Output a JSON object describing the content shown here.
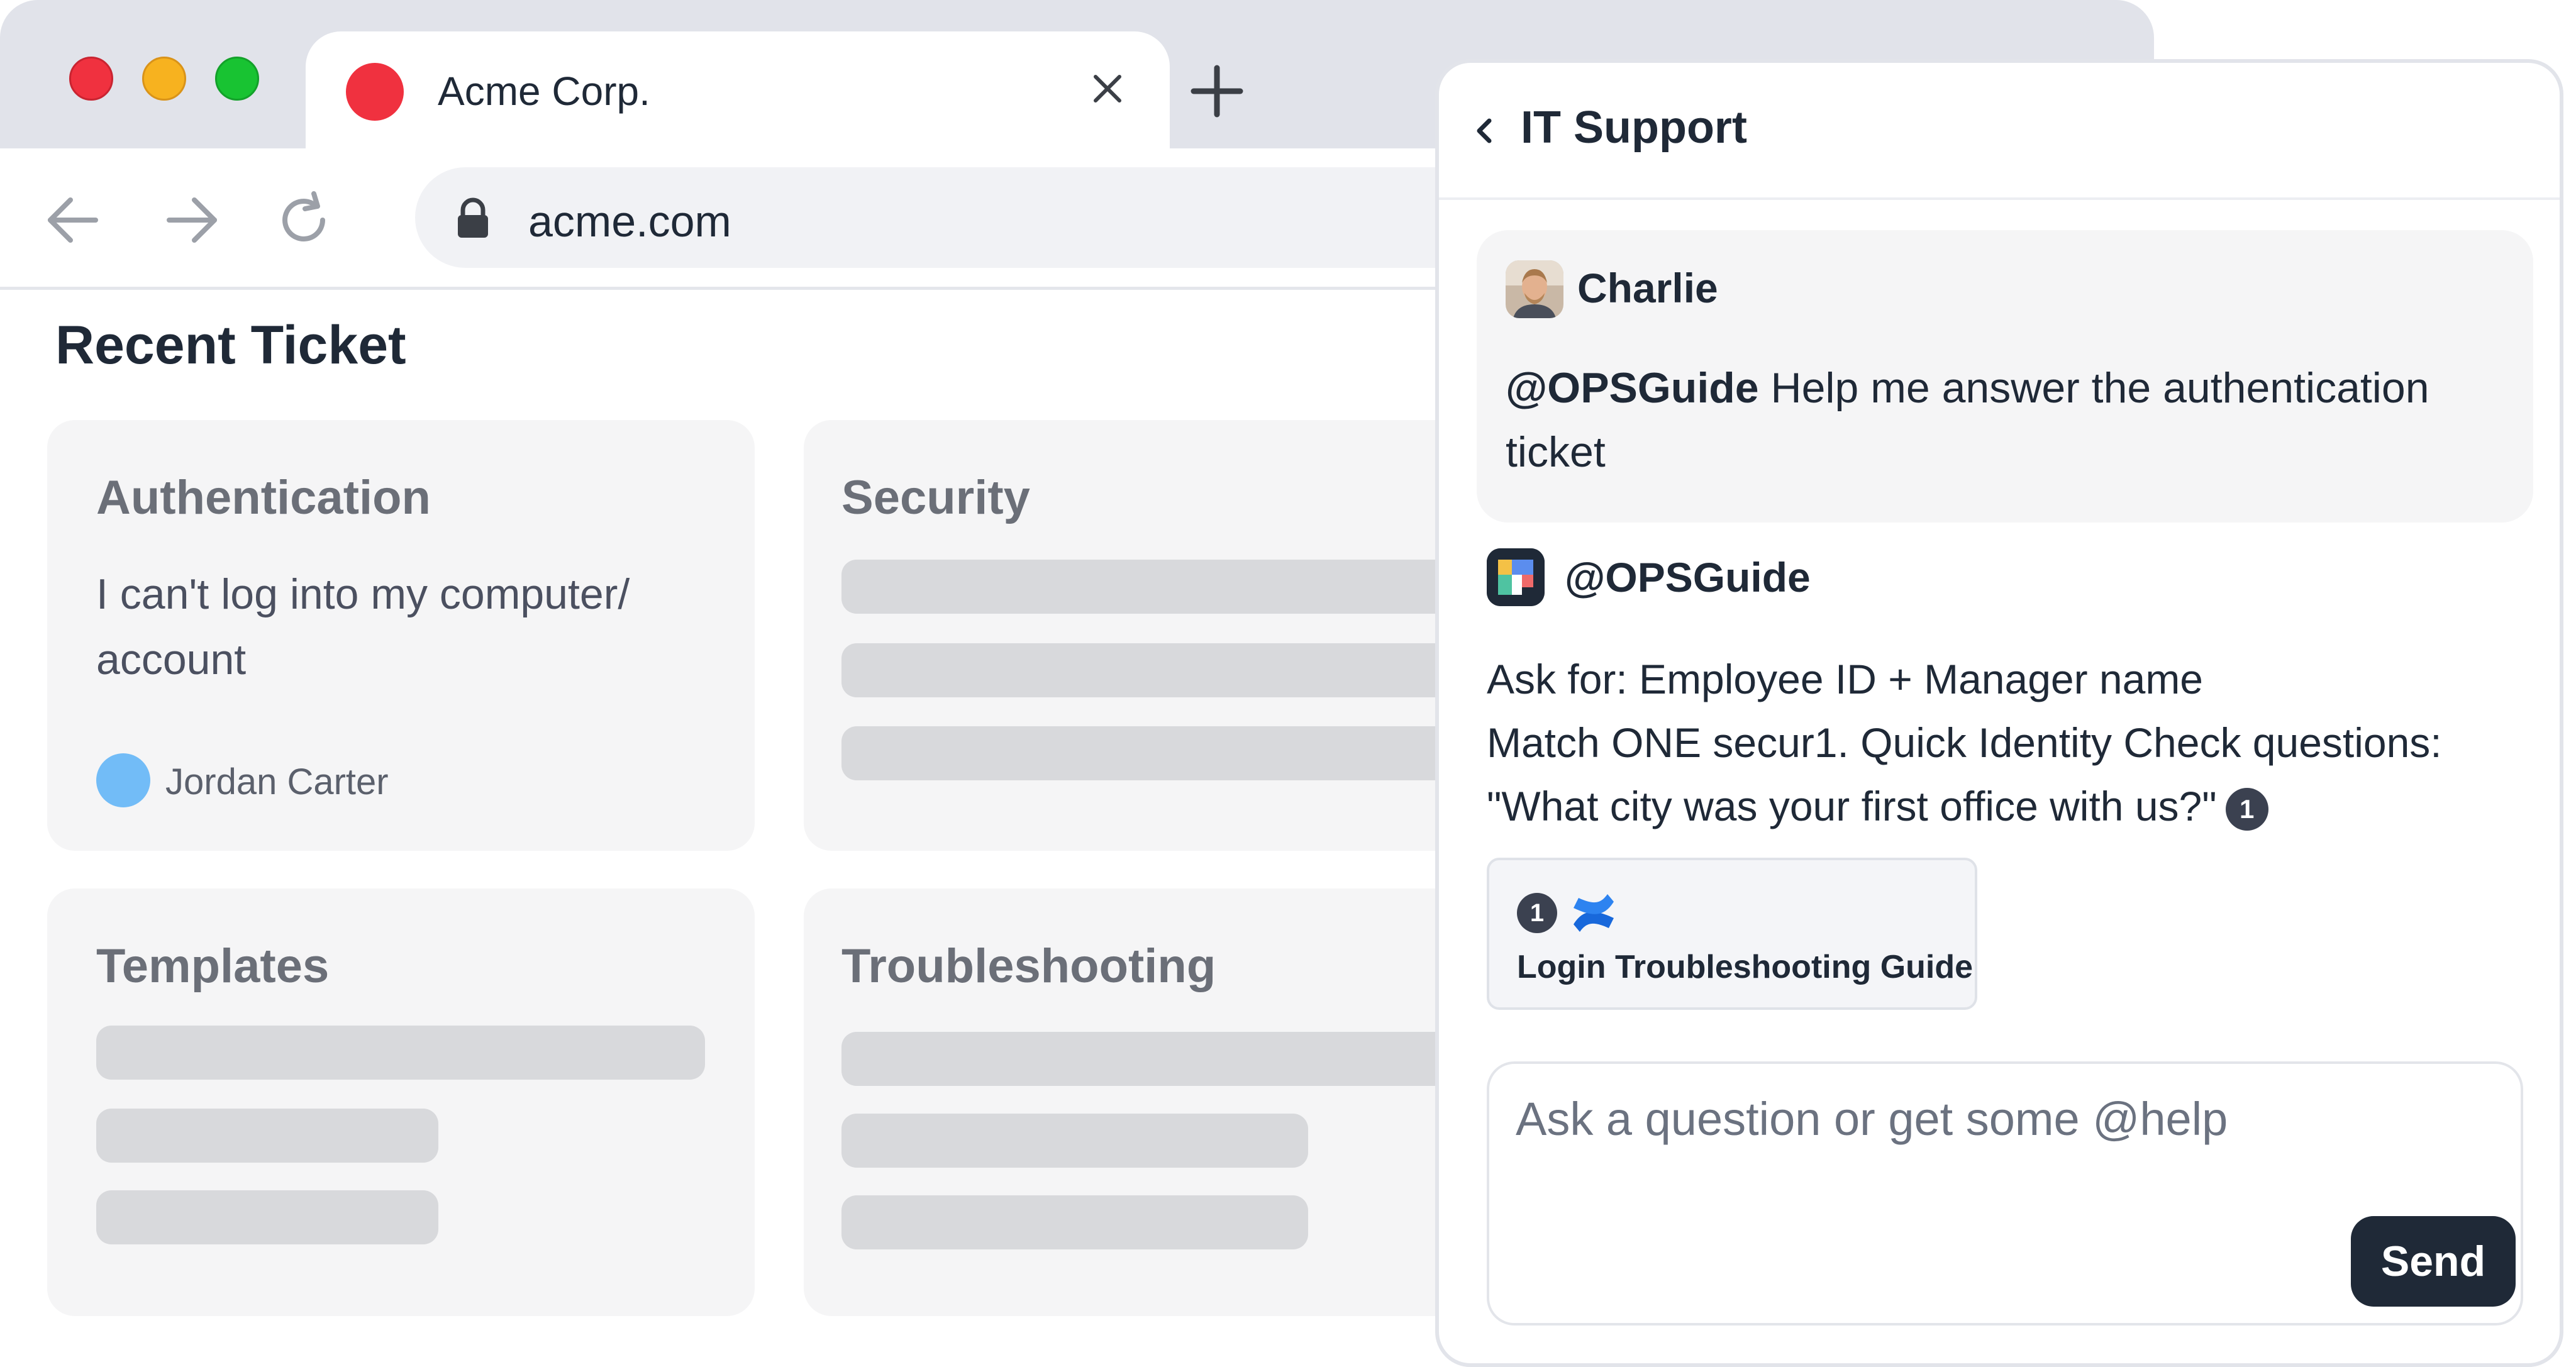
{
  "browser": {
    "tab": {
      "title": "Acme Corp.",
      "favicon_color": "#F0313F"
    },
    "address": {
      "url": "acme.com"
    },
    "icons": [
      "back-arrow-icon",
      "forward-arrow-icon",
      "reload-icon",
      "lock-icon",
      "close-icon",
      "plus-icon"
    ]
  },
  "page": {
    "title": "Recent Ticket",
    "cards": [
      {
        "title": "Authentication",
        "description": "I can't log into my computer/ account",
        "author": "Jordan Carter"
      },
      {
        "title": "Security"
      },
      {
        "title": "Templates"
      },
      {
        "title": "Troubleshooting"
      }
    ]
  },
  "chat": {
    "title": "IT Support",
    "user_message": {
      "name": "Charlie",
      "mention": "@OPSGuide",
      "text": " Help me answer the authentication ticket"
    },
    "bot_message": {
      "name": "@OPSGuide",
      "line1": "Ask for: Employee ID + Manager name",
      "line2": "Match ONE secur1. Quick Identity Check questions:",
      "line3": "\"What city was your first office with us?\"",
      "citation": "1"
    },
    "source": {
      "number": "1",
      "title": "Login Troubleshooting Guide",
      "icon": "confluence-icon"
    },
    "input": {
      "placeholder": "Ask a question or get some @help",
      "value": ""
    },
    "send_label": "Send"
  }
}
